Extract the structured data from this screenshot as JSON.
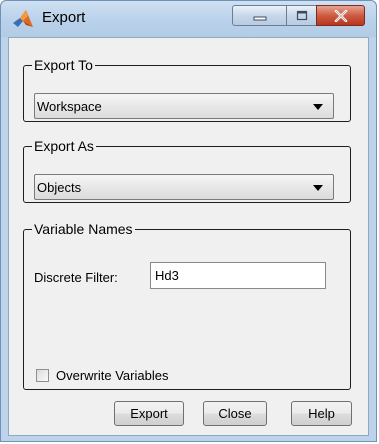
{
  "window": {
    "title": "Export",
    "app_icon": "matlab-membrane-icon",
    "controls": {
      "minimize_icon": "minimize-icon",
      "maximize_icon": "maximize-icon",
      "close_icon": "close-icon"
    }
  },
  "export_to": {
    "legend": "Export To",
    "selected": "Workspace"
  },
  "export_as": {
    "legend": "Export As",
    "selected": "Objects"
  },
  "variable_names": {
    "legend": "Variable Names",
    "field_label": "Discrete Filter:",
    "field_value": "Hd3"
  },
  "overwrite": {
    "label": "Overwrite Variables",
    "checked": false
  },
  "buttons": {
    "export": "Export",
    "close": "Close",
    "help": "Help"
  },
  "colors": {
    "frame": "#bcd3ea",
    "client_bg": "#f0f0f0",
    "close_button": "#c8452b"
  }
}
